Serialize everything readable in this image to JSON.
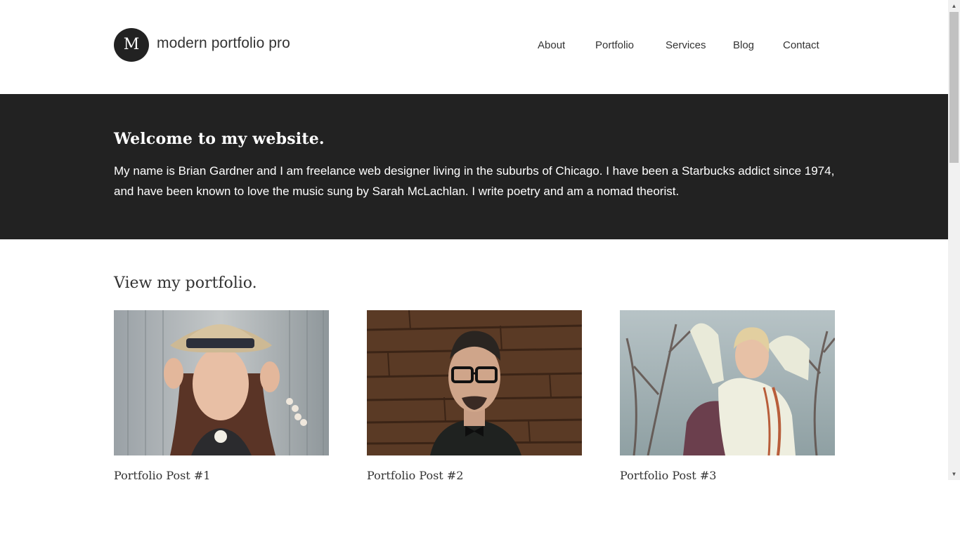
{
  "header": {
    "logo_letter": "M",
    "site_title": "modern portfolio pro",
    "nav": [
      {
        "label": "About"
      },
      {
        "label": "Portfolio"
      },
      {
        "label": "Services"
      },
      {
        "label": "Blog"
      },
      {
        "label": "Contact"
      }
    ]
  },
  "welcome": {
    "heading": "Welcome to my website.",
    "body": "My name is Brian Gardner and I am freelance web designer living in the suburbs of Chicago. I have been a Starbucks addict since 1974, and have been known to love the music sung by Sarah McLachlan. I write poetry and am a nomad theorist."
  },
  "portfolio": {
    "heading": "View my portfolio.",
    "items": [
      {
        "title": "Portfolio Post #1"
      },
      {
        "title": "Portfolio Post #2"
      },
      {
        "title": "Portfolio Post #3"
      }
    ]
  },
  "colors": {
    "band": "#222222",
    "text": "#333333",
    "background": "#ffffff"
  }
}
